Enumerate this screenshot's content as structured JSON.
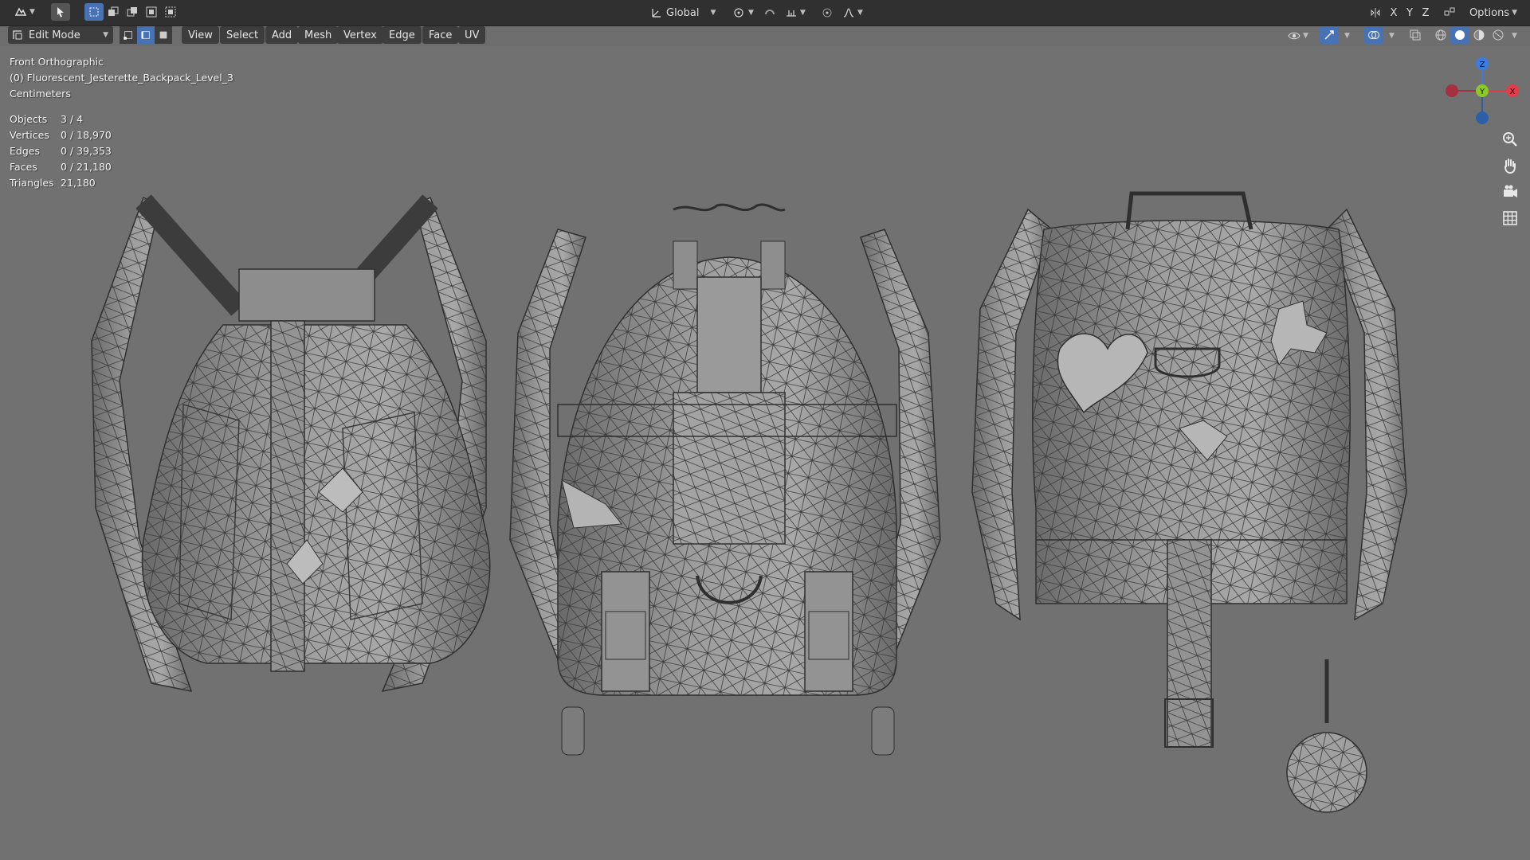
{
  "topbar": {
    "transform_orientation": "Global",
    "axes": [
      "X",
      "Y",
      "Z"
    ],
    "options_label": "Options"
  },
  "header2": {
    "mode_label": "Edit Mode",
    "menus": [
      "View",
      "Select",
      "Add",
      "Mesh",
      "Vertex",
      "Edge",
      "Face",
      "UV"
    ]
  },
  "viewport": {
    "view_name": "Front Orthographic",
    "object_name": "(0) Fluorescent_Jesterette_Backpack_Level_3",
    "units": "Centimeters",
    "stats": [
      {
        "label": "Objects",
        "value": "3 / 4"
      },
      {
        "label": "Vertices",
        "value": "0 / 18,970"
      },
      {
        "label": "Edges",
        "value": "0 / 39,353"
      },
      {
        "label": "Faces",
        "value": "0 / 21,180"
      },
      {
        "label": "Triangles",
        "value": "21,180"
      }
    ]
  },
  "gizmo": {
    "z_label": "Z",
    "y_label": "Y",
    "x_label": "X",
    "colors": {
      "x": "#e23b4a",
      "y": "#8ac926",
      "z": "#3b7be2"
    }
  },
  "icons": {
    "nav": [
      "zoom-icon",
      "hand-icon",
      "camera-icon",
      "grid-icon"
    ]
  }
}
